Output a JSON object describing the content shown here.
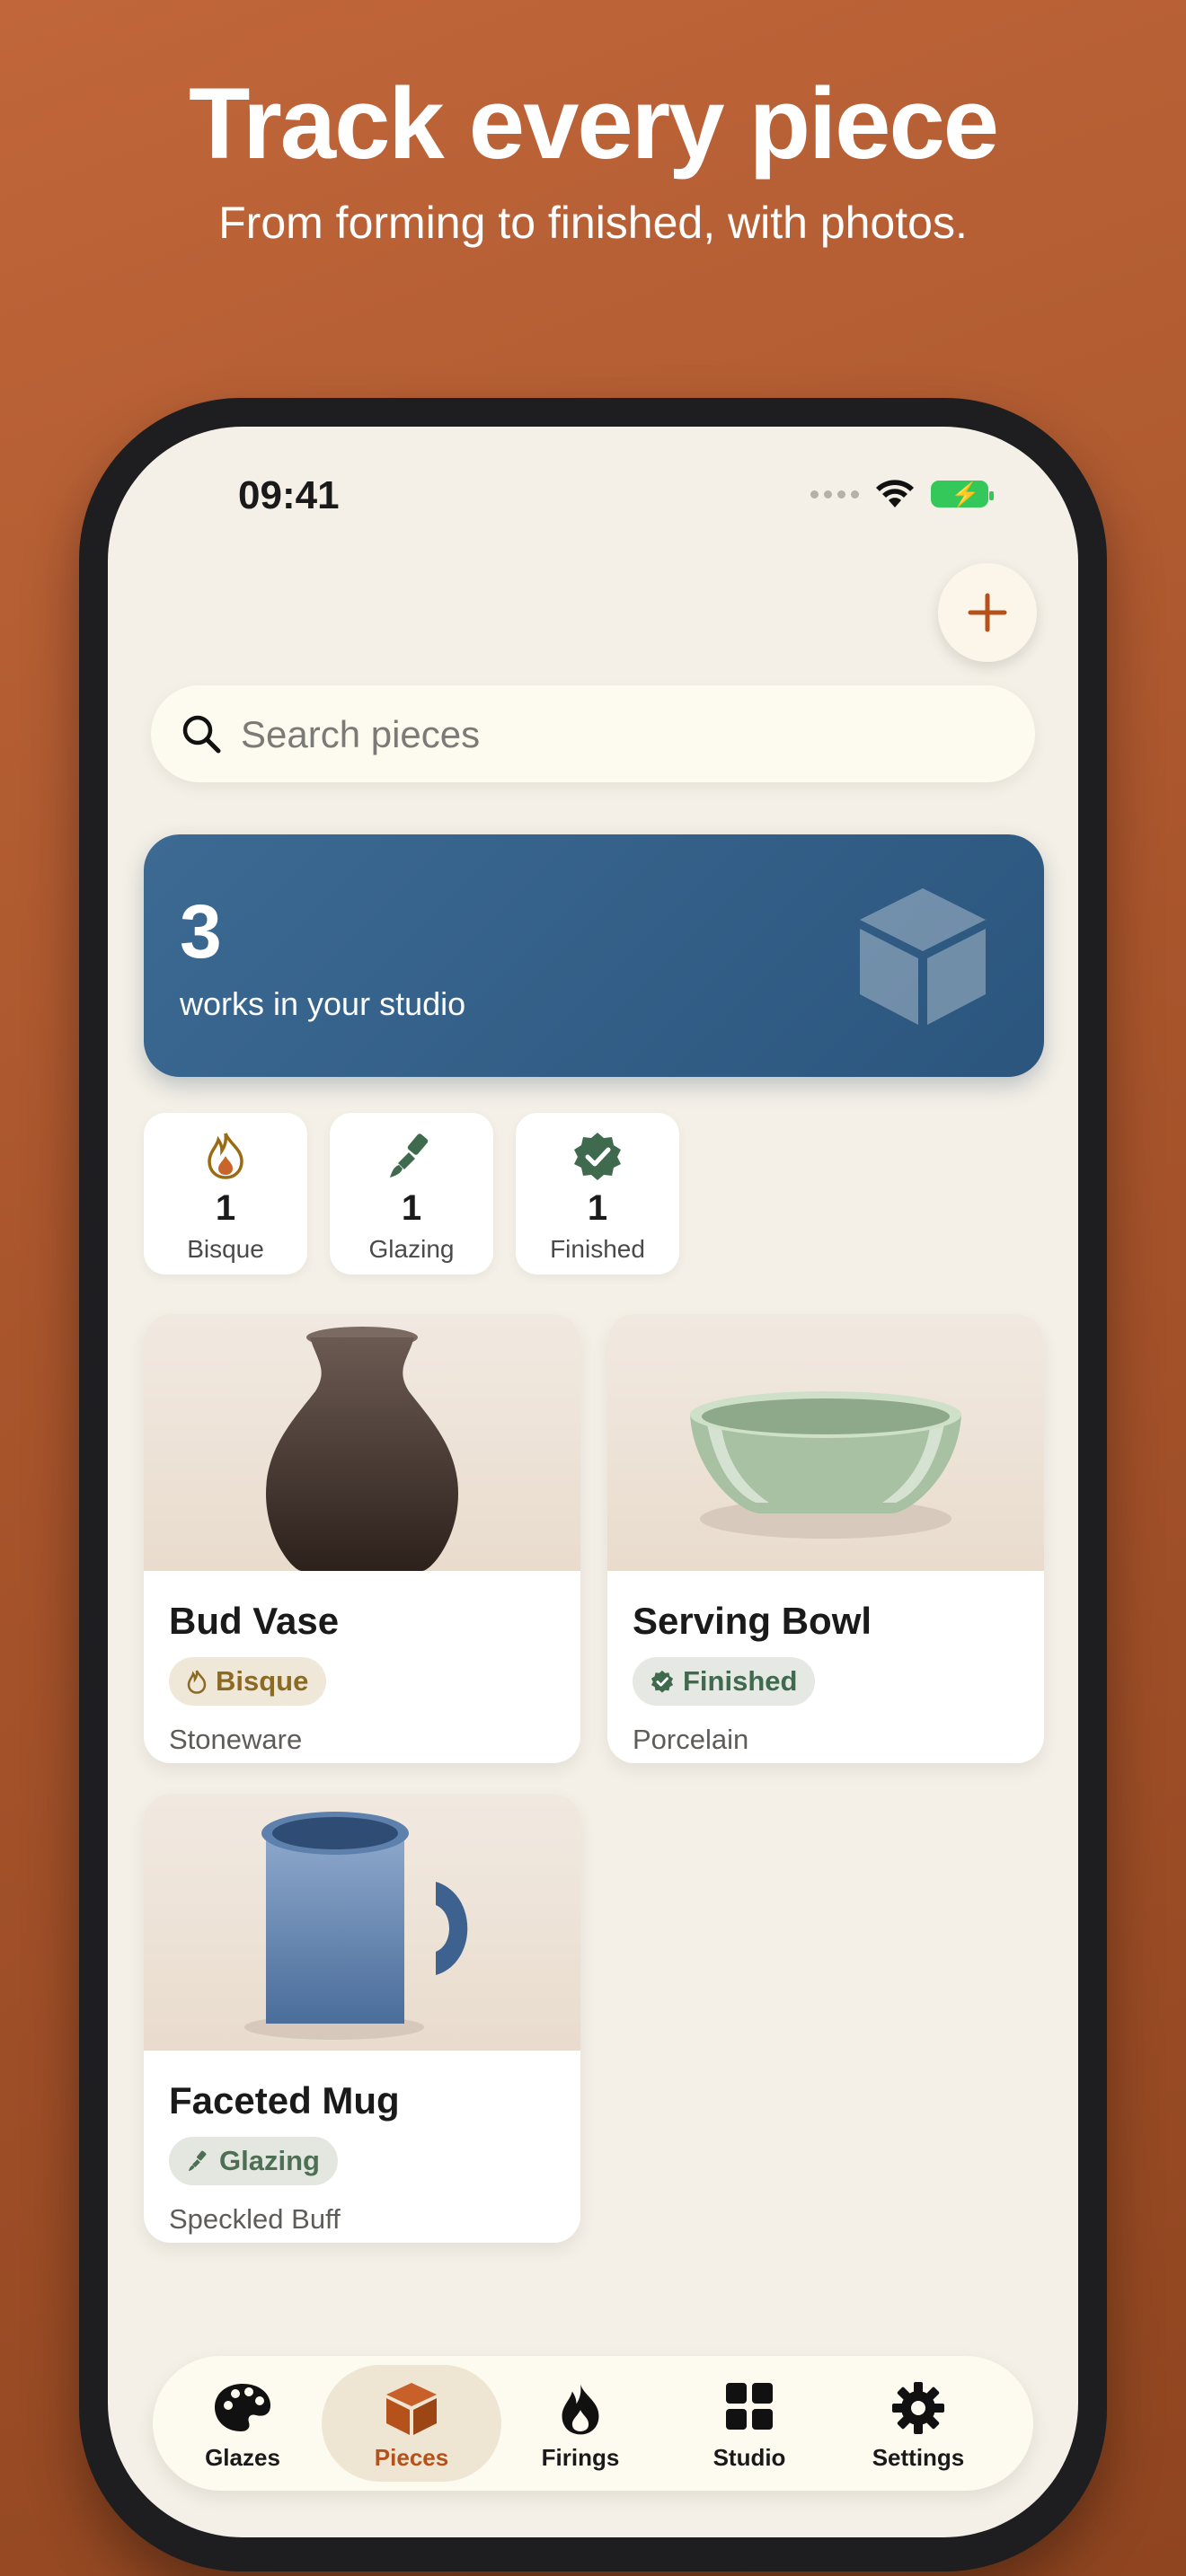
{
  "marketing": {
    "headline": "Track every piece",
    "subhead": "From forming to finished, with photos."
  },
  "status_bar": {
    "time": "09:41",
    "icons": [
      "signal-dots-icon",
      "wifi-icon",
      "battery-charging-icon"
    ],
    "battery_color": "#34c759"
  },
  "header": {
    "add_icon": "plus-icon"
  },
  "search": {
    "placeholder": "Search pieces",
    "value": "",
    "icon": "search-icon"
  },
  "summary": {
    "count": "3",
    "label": "works in your studio",
    "icon": "cube-icon",
    "color": "#2f5a82"
  },
  "stats": [
    {
      "count": "1",
      "label": "Bisque",
      "icon": "flame-icon",
      "color": "#9a6b12"
    },
    {
      "count": "1",
      "label": "Glazing",
      "icon": "paintbrush-icon",
      "color": "#3f6a4e"
    },
    {
      "count": "1",
      "label": "Finished",
      "icon": "verified-check-icon",
      "color": "#3f6a4e"
    }
  ],
  "pieces": [
    {
      "title": "Bud Vase",
      "status": "Bisque",
      "material": "Stoneware",
      "image": "vase-illustration"
    },
    {
      "title": "Serving Bowl",
      "status": "Finished",
      "material": "Porcelain",
      "image": "bowl-illustration"
    },
    {
      "title": "Faceted Mug",
      "status": "Glazing",
      "material": "Speckled Buff",
      "image": "mug-illustration"
    }
  ],
  "tabbar": {
    "active": "Pieces",
    "accent": "#b5521c",
    "tabs": [
      {
        "label": "Glazes",
        "icon": "palette-icon"
      },
      {
        "label": "Pieces",
        "icon": "cube-icon"
      },
      {
        "label": "Firings",
        "icon": "flame-icon"
      },
      {
        "label": "Studio",
        "icon": "grid-icon"
      },
      {
        "label": "Settings",
        "icon": "gear-icon"
      }
    ]
  }
}
